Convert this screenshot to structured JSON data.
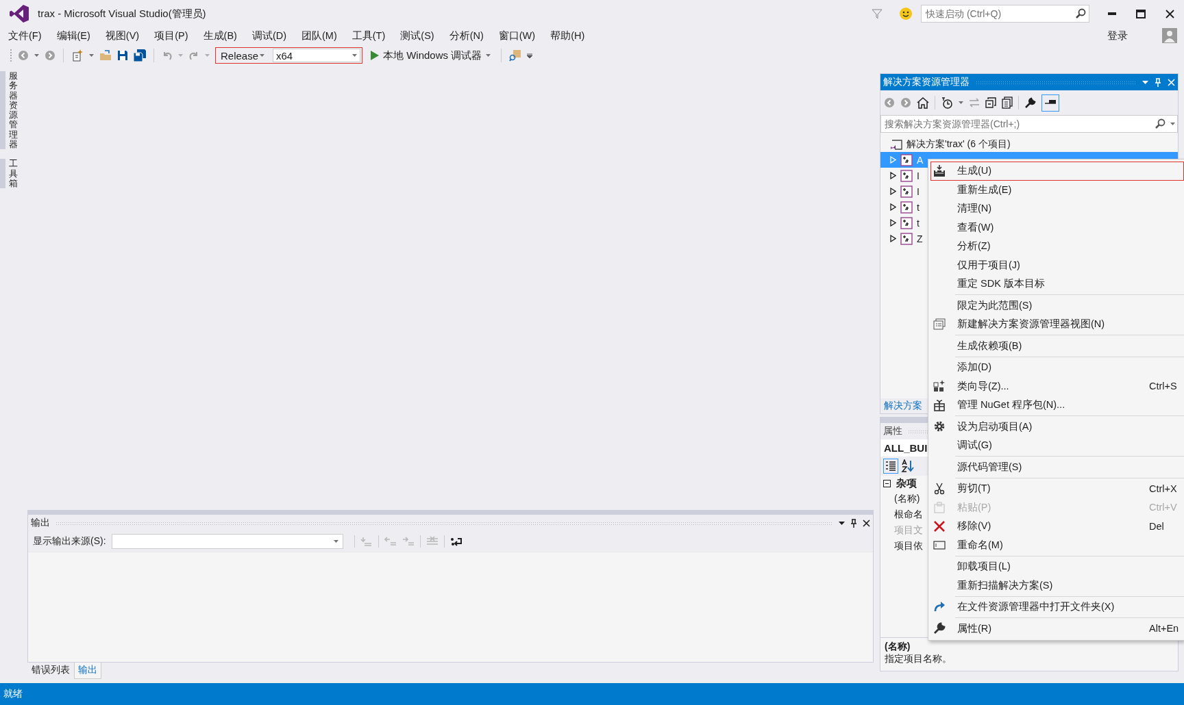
{
  "window": {
    "title": "trax - Microsoft Visual Studio(管理员)",
    "quick_launch": {
      "placeholder": "快速启动 (Ctrl+Q)"
    },
    "sign_in": "登录"
  },
  "menu_bar": [
    "文件(F)",
    "编辑(E)",
    "视图(V)",
    "项目(P)",
    "生成(B)",
    "调试(D)",
    "团队(M)",
    "工具(T)",
    "测试(S)",
    "分析(N)",
    "窗口(W)",
    "帮助(H)"
  ],
  "toolbar": {
    "configuration": "Release",
    "platform": "x64",
    "debugger": "本地 Windows 调试器"
  },
  "side_tabs": [
    "服务器资源管理器",
    "工具箱"
  ],
  "solution_explorer": {
    "title": "解决方案资源管理器",
    "search": {
      "placeholder": "搜索解决方案资源管理器(Ctrl+;)"
    },
    "solution": "解决方案'trax' (6 个项目)",
    "projects": [
      {
        "label": "A",
        "selected": true,
        "expanded": false
      },
      {
        "label": "I",
        "selected": false,
        "expanded": false
      },
      {
        "label": "I",
        "selected": false,
        "expanded": false
      },
      {
        "label": "t",
        "selected": false,
        "expanded": false
      },
      {
        "label": "t",
        "selected": false,
        "expanded": false
      },
      {
        "label": "Z",
        "selected": false,
        "expanded": false
      }
    ],
    "tab": "解决方案"
  },
  "properties": {
    "title": "属性",
    "object": "ALL_BUI",
    "category": "杂项",
    "expanded": true,
    "rows": [
      {
        "name": "(名称)",
        "disabled": false
      },
      {
        "name": "根命名",
        "disabled": false
      },
      {
        "name": "项目文",
        "disabled": true
      },
      {
        "name": "项目依",
        "disabled": false
      }
    ],
    "description_title": "(名称)",
    "description": "指定项目名称。"
  },
  "output": {
    "title": "输出",
    "source_label": "显示输出来源(S):",
    "tabs": [
      {
        "label": "错误列表",
        "selected": false
      },
      {
        "label": "输出",
        "selected": true
      }
    ]
  },
  "context_menu": {
    "groups": [
      [
        {
          "label": "生成(U)",
          "selected": true,
          "disabled": false
        },
        {
          "label": "重新生成(E)",
          "selected": false,
          "disabled": false
        },
        {
          "label": "清理(N)",
          "selected": false,
          "disabled": false
        },
        {
          "label": "查看(W)",
          "selected": false,
          "disabled": false
        },
        {
          "label": "分析(Z)",
          "selected": false,
          "disabled": false
        },
        {
          "label": "仅用于项目(J)",
          "selected": false,
          "disabled": false
        },
        {
          "label": "重定 SDK 版本目标",
          "selected": false,
          "disabled": false
        }
      ],
      [
        {
          "label": "限定为此范围(S)",
          "selected": false,
          "disabled": false
        },
        {
          "label": "新建解决方案资源管理器视图(N)",
          "selected": false,
          "disabled": false
        }
      ],
      [
        {
          "label": "生成依赖项(B)",
          "selected": false,
          "disabled": false
        }
      ],
      [
        {
          "label": "添加(D)",
          "selected": false,
          "disabled": false
        },
        {
          "label": "类向导(Z)...",
          "shortcut": "Ctrl+S",
          "selected": false,
          "disabled": false
        },
        {
          "label": "管理 NuGet 程序包(N)...",
          "selected": false,
          "disabled": false
        }
      ],
      [
        {
          "label": "设为启动项目(A)",
          "selected": false,
          "disabled": false
        },
        {
          "label": "调试(G)",
          "selected": false,
          "disabled": false
        }
      ],
      [
        {
          "label": "源代码管理(S)",
          "selected": false,
          "disabled": false
        }
      ],
      [
        {
          "label": "剪切(T)",
          "shortcut": "Ctrl+X",
          "selected": false,
          "disabled": false
        },
        {
          "label": "粘贴(P)",
          "shortcut": "Ctrl+V",
          "selected": false,
          "disabled": true
        },
        {
          "label": "移除(V)",
          "shortcut": "Del",
          "selected": false,
          "disabled": false
        },
        {
          "label": "重命名(M)",
          "selected": false,
          "disabled": false
        }
      ],
      [
        {
          "label": "卸载项目(L)",
          "selected": false,
          "disabled": false
        },
        {
          "label": "重新扫描解决方案(S)",
          "selected": false,
          "disabled": false
        }
      ],
      [
        {
          "label": "在文件资源管理器中打开文件夹(X)",
          "selected": false,
          "disabled": false
        }
      ],
      [
        {
          "label": "属性(R)",
          "shortcut": "Alt+En",
          "selected": false,
          "disabled": false
        }
      ]
    ]
  },
  "status_bar": "就绪"
}
